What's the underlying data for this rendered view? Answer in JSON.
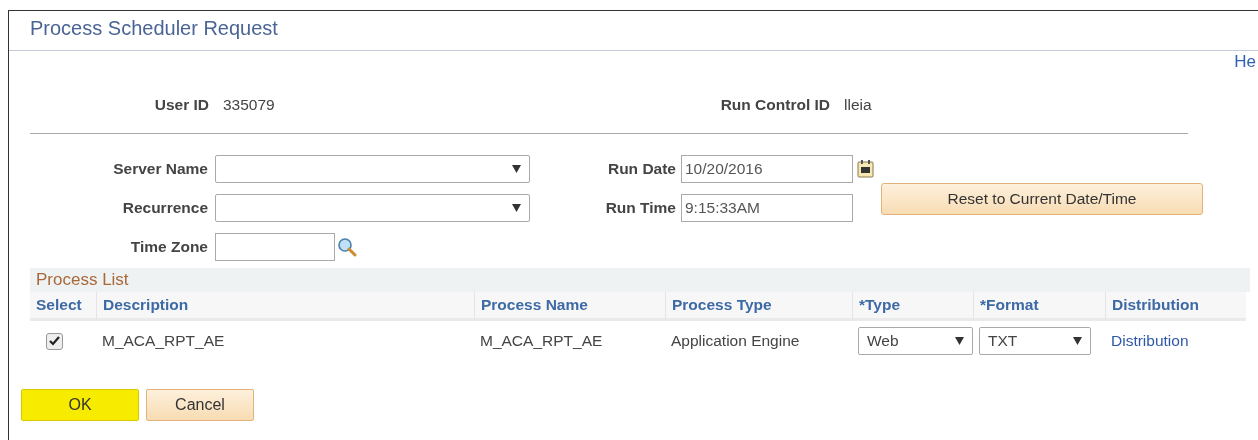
{
  "window": {
    "title": "Process Scheduler Request"
  },
  "help_link": "He",
  "ids": [
    {
      "label": "User ID",
      "value": "335079"
    },
    {
      "label": "Run Control ID",
      "value": "lleia"
    }
  ],
  "server_name": {
    "label": "Server Name"
  },
  "recurrence": {
    "label": "Recurrence"
  },
  "time_zone": {
    "label": "Time Zone"
  },
  "run_date": {
    "label": "Run Date",
    "value": "10/20/2016"
  },
  "run_time": {
    "label": "Run Time",
    "value": "9:15:33AM"
  },
  "reset_button": "Reset to Current Date/Time",
  "process_list": {
    "title": "Process List",
    "columns": [
      "Select",
      "Description",
      "Process Name",
      "Process Type",
      "*Type",
      "*Format",
      "Distribution"
    ],
    "rows": [
      {
        "checked": true,
        "description": "M_ACA_RPT_AE",
        "process_name": "M_ACA_RPT_AE",
        "process_type": "Application Engine",
        "type": "Web",
        "format": "TXT",
        "distribution": "Distribution"
      }
    ]
  },
  "buttons": [
    {
      "label": "OK",
      "highlighted": true
    },
    {
      "label": "Cancel",
      "highlighted": false
    }
  ]
}
